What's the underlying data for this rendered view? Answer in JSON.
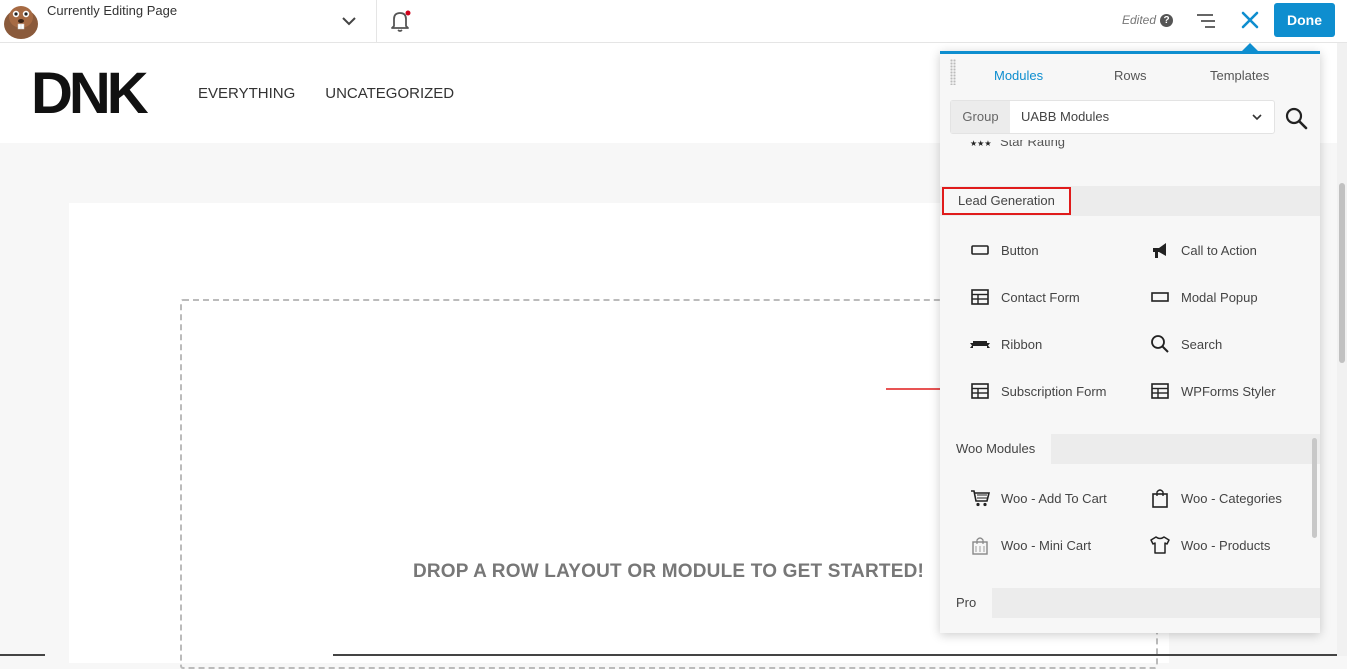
{
  "topbar": {
    "title": "Currently Editing Page",
    "edited_label": "Edited",
    "help_glyph": "?",
    "done_label": "Done",
    "accent_color": "#0e8ecf",
    "notification_dot_color": "#d0021b"
  },
  "site": {
    "logo_text": "DNK",
    "nav": [
      "EVERYTHING",
      "UNCATEGORIZED"
    ]
  },
  "content": {
    "drop_prompt": "DROP A ROW LAYOUT OR MODULE TO GET STARTED!"
  },
  "panel": {
    "tabs": [
      "Modules",
      "Rows",
      "Templates"
    ],
    "active_tab": "Modules",
    "group_label": "Group",
    "group_value": "UABB Modules",
    "partial_item": "Star Rating",
    "sections": [
      {
        "title": "Lead Generation",
        "highlighted": true,
        "modules": [
          {
            "label": "Button",
            "icon": "button-icon"
          },
          {
            "label": "Call to Action",
            "icon": "megaphone-icon"
          },
          {
            "label": "Contact Form",
            "icon": "form-icon"
          },
          {
            "label": "Modal Popup",
            "icon": "popup-icon"
          },
          {
            "label": "Ribbon",
            "icon": "ribbon-icon"
          },
          {
            "label": "Search",
            "icon": "search-icon"
          },
          {
            "label": "Subscription Form",
            "icon": "form-icon"
          },
          {
            "label": "WPForms Styler",
            "icon": "form-icon"
          }
        ]
      },
      {
        "title": "Woo Modules",
        "highlighted": false,
        "modules": [
          {
            "label": "Woo - Add To Cart",
            "icon": "cart-icon"
          },
          {
            "label": "Woo - Categories",
            "icon": "bag-icon"
          },
          {
            "label": "Woo - Mini Cart",
            "icon": "mini-bag-icon"
          },
          {
            "label": "Woo - Products",
            "icon": "shirt-icon"
          }
        ]
      },
      {
        "title": "Pro",
        "highlighted": false,
        "modules": []
      }
    ]
  },
  "annotation": {
    "arrow_color": "#e01b1b",
    "points_to": "Subscription Form"
  }
}
